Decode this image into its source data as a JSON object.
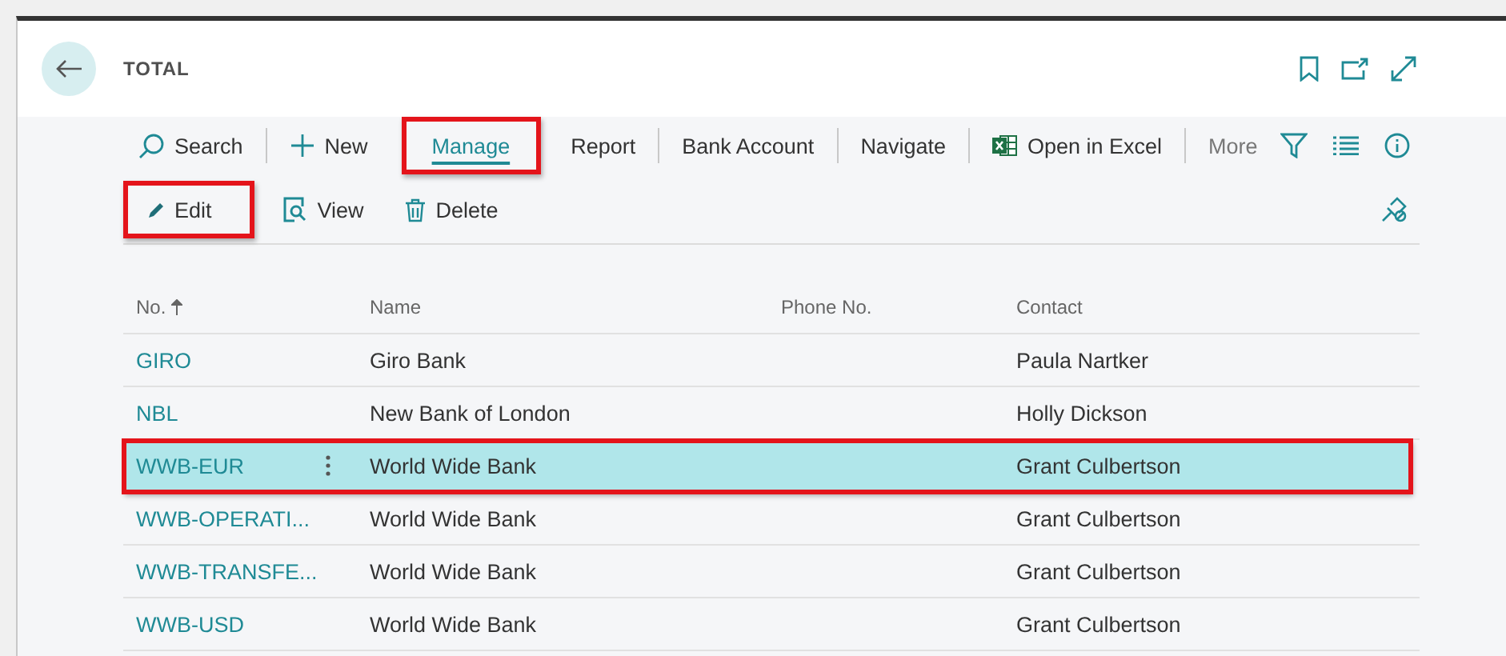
{
  "page": {
    "title": "TOTAL"
  },
  "action_groups": [
    [
      {
        "kind": "search",
        "label": "Search",
        "selected": false,
        "highlighted": false
      }
    ],
    [
      {
        "kind": "new",
        "label": "New",
        "selected": false,
        "highlighted": false
      },
      {
        "kind": "tab",
        "label": "Manage",
        "selected": true,
        "highlighted": true
      },
      {
        "kind": "tab",
        "label": "Report",
        "selected": false,
        "highlighted": false
      }
    ],
    [
      {
        "kind": "tab",
        "label": "Bank Account",
        "selected": false,
        "highlighted": false
      }
    ],
    [
      {
        "kind": "tab",
        "label": "Navigate",
        "selected": false,
        "highlighted": false
      }
    ],
    [
      {
        "kind": "excel",
        "label": "Open in Excel",
        "selected": false,
        "highlighted": false
      }
    ],
    [
      {
        "kind": "more",
        "label": "More",
        "selected": false,
        "highlighted": false
      }
    ]
  ],
  "sub_actions": [
    {
      "kind": "edit",
      "label": "Edit",
      "highlighted": true
    },
    {
      "kind": "view",
      "label": "View",
      "highlighted": false
    },
    {
      "kind": "delete",
      "label": "Delete",
      "highlighted": false
    }
  ],
  "table": {
    "columns": [
      {
        "label": "No.",
        "sorted_ascending": true
      },
      {
        "label": "Name",
        "sorted_ascending": false
      },
      {
        "label": "Phone No.",
        "sorted_ascending": false
      },
      {
        "label": "Contact",
        "sorted_ascending": false
      }
    ],
    "rows": [
      {
        "no": "GIRO",
        "name": "Giro Bank",
        "contact": "Paula Nartker",
        "selected": false,
        "highlighted": false
      },
      {
        "no": "NBL",
        "name": "New Bank of London",
        "contact": "Holly Dickson",
        "selected": false,
        "highlighted": false
      },
      {
        "no": "WWB-EUR",
        "name": "World Wide Bank",
        "contact": "Grant Culbertson",
        "selected": true,
        "highlighted": true
      },
      {
        "no": "WWB-OPERATI...",
        "name": "World Wide Bank",
        "contact": "Grant Culbertson",
        "selected": false,
        "highlighted": false
      },
      {
        "no": "WWB-TRANSFE...",
        "name": "World Wide Bank",
        "contact": "Grant Culbertson",
        "selected": false,
        "highlighted": false
      },
      {
        "no": "WWB-USD",
        "name": "World Wide Bank",
        "contact": "Grant Culbertson",
        "selected": false,
        "highlighted": false
      }
    ]
  }
}
